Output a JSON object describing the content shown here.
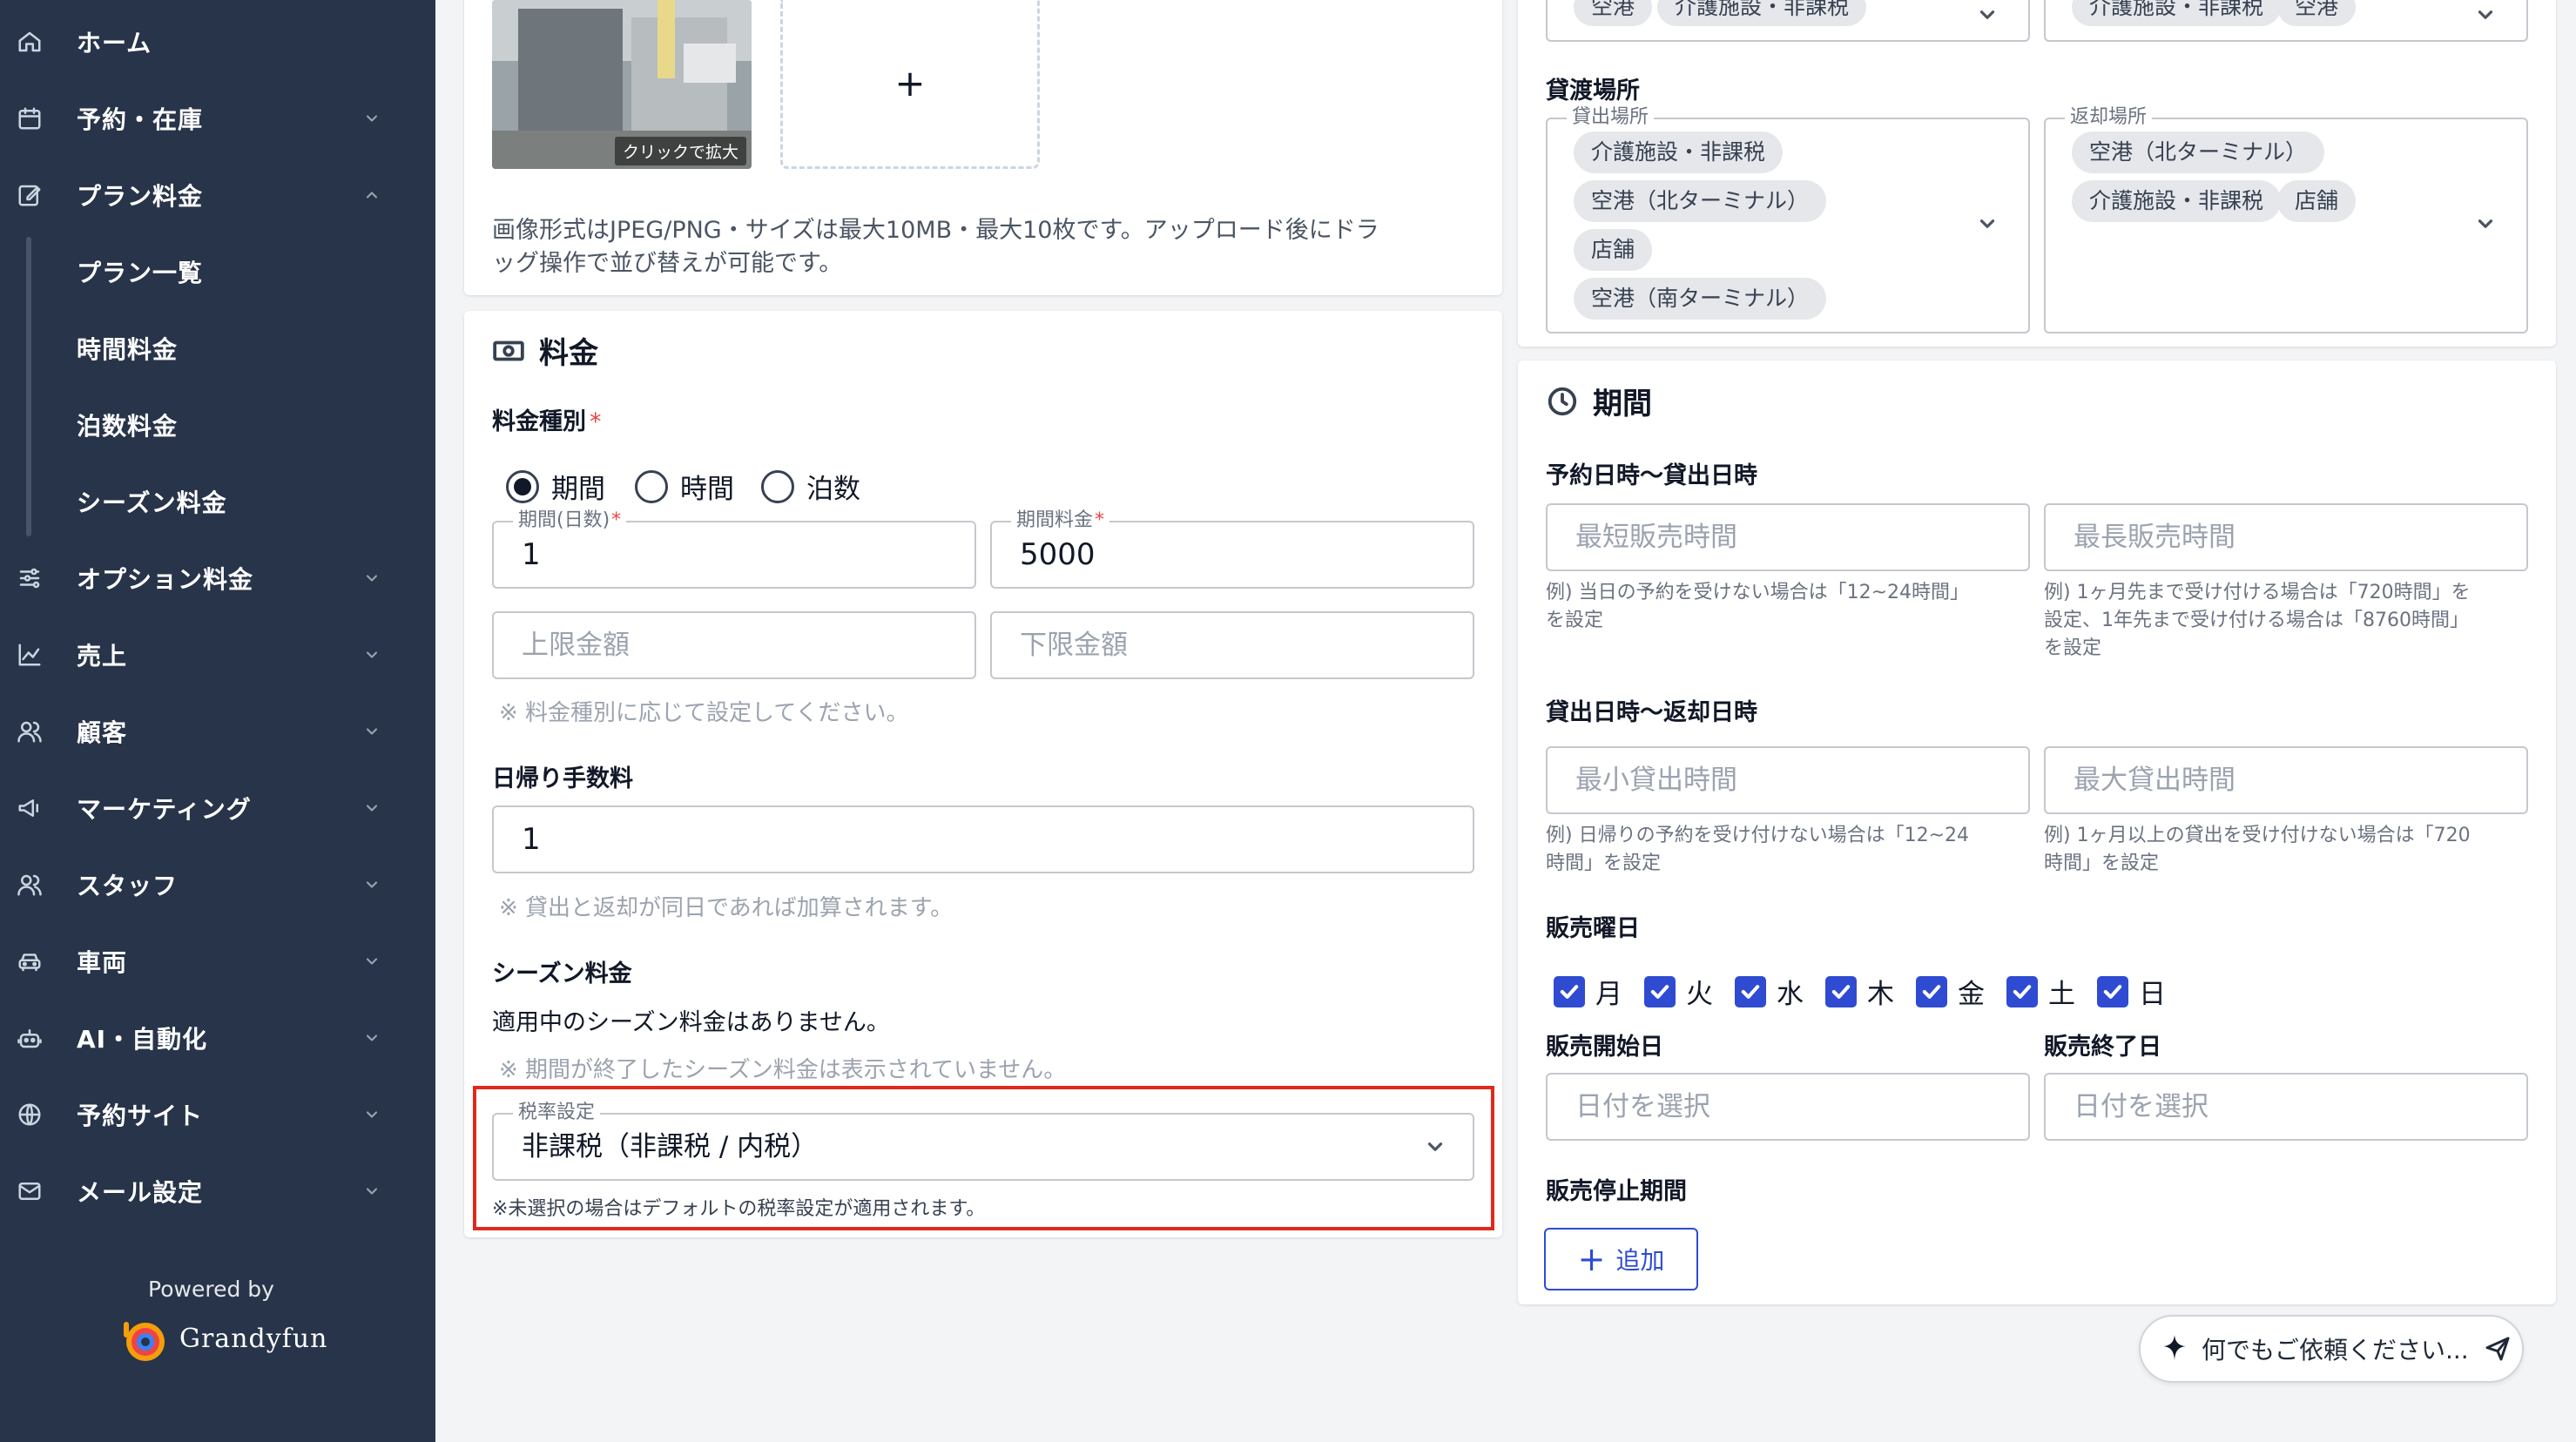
{
  "sidebar": {
    "items": [
      {
        "label": "ホーム",
        "icon": "home-icon"
      },
      {
        "label": "予約・在庫",
        "icon": "calendar-icon"
      },
      {
        "label": "プラン料金",
        "icon": "edit-icon"
      },
      {
        "label": "オプション料金",
        "icon": "sliders-icon"
      },
      {
        "label": "売上",
        "icon": "chart-icon"
      },
      {
        "label": "顧客",
        "icon": "users-icon"
      },
      {
        "label": "マーケティング",
        "icon": "megaphone-icon"
      },
      {
        "label": "スタッフ",
        "icon": "staff-icon"
      },
      {
        "label": "車両",
        "icon": "car-icon"
      },
      {
        "label": "AI・自動化",
        "icon": "robot-icon"
      },
      {
        "label": "予約サイト",
        "icon": "globe-icon"
      },
      {
        "label": "メール設定",
        "icon": "mail-icon"
      }
    ],
    "sub_items": [
      "プラン一覧",
      "時間料金",
      "泊数料金",
      "シーズン料金"
    ],
    "powered_by": "Powered by",
    "brand": "Grandyfun"
  },
  "images": {
    "thumb_tag": "クリックで拡大",
    "add_symbol": "+",
    "note_line1": "画像形式はJPEG/PNG・サイズは最大10MB・最大10枚です。アップロード後にドラ",
    "note_line2": "ッグ操作で並び替えが可能です。"
  },
  "pricing": {
    "title": "料金",
    "type_label": "料金種別",
    "required_mark": "*",
    "options": [
      "期間",
      "時間",
      "泊数"
    ],
    "selected_option": "期間",
    "period_days": {
      "label": "期間(日数)",
      "value": "1"
    },
    "period_price": {
      "label": "期間料金",
      "value": "5000"
    },
    "max_amount_placeholder": "上限金額",
    "min_amount_placeholder": "下限金額",
    "type_hint": "※ 料金種別に応じて設定してください。",
    "day_trip_label": "日帰り手数料",
    "day_trip_value": "1",
    "day_trip_hint": "※ 貸出と返却が同日であれば加算されます。",
    "season_label": "シーズン料金",
    "season_none": "適用中のシーズン料金はありません。",
    "season_hint": "※ 期間が終了したシーズン料金は表示されていません。",
    "tax": {
      "label": "税率設定",
      "value": "非課税（非課税 / 内税）",
      "hint": "※未選択の場合はデフォルトの税率設定が適用されます。"
    }
  },
  "locations": {
    "top_left_chips": [
      "空港",
      "介護施設・非課税"
    ],
    "top_right_chips": [
      "介護施設・非課税",
      "空港"
    ],
    "title": "貸渡場所",
    "pickup": {
      "label": "貸出場所",
      "chips": [
        "介護施設・非課税",
        "空港（北ターミナル）",
        "店舗",
        "空港（南ターミナル）"
      ]
    },
    "return": {
      "label": "返却場所",
      "chips": [
        "空港（北ターミナル）",
        "介護施設・非課税",
        "店舗"
      ]
    }
  },
  "period": {
    "title": "期間",
    "booking_label": "予約日時〜貸出日時",
    "min_sale_placeholder": "最短販売時間",
    "max_sale_placeholder": "最長販売時間",
    "min_sale_help": [
      "例) 当日の予約を受けない場合は「12~24時間」",
      "を設定"
    ],
    "max_sale_help": [
      "例) 1ヶ月先まで受け付ける場合は「720時間」を",
      "設定、1年先まで受け付ける場合は「8760時間」",
      "を設定"
    ],
    "rental_label": "貸出日時〜返却日時",
    "min_rental_placeholder": "最小貸出時間",
    "max_rental_placeholder": "最大貸出時間",
    "min_rental_help": [
      "例) 日帰りの予約を受け付けない場合は「12~24",
      "時間」を設定"
    ],
    "max_rental_help": [
      "例) 1ヶ月以上の貸出を受け付けない場合は「720",
      "時間」を設定"
    ],
    "weekday_label": "販売曜日",
    "weekdays": [
      "月",
      "火",
      "水",
      "木",
      "金",
      "土",
      "日"
    ],
    "start_label": "販売開始日",
    "end_label": "販売終了日",
    "date_placeholder": "日付を選択",
    "stop_label": "販売停止期間",
    "add_button": "追加"
  },
  "assistant": {
    "placeholder": "何でもご依頼ください..."
  },
  "colors": {
    "sidebar_bg": "#273449",
    "accent": "#2f4bd1",
    "highlight": "#e0291b"
  }
}
